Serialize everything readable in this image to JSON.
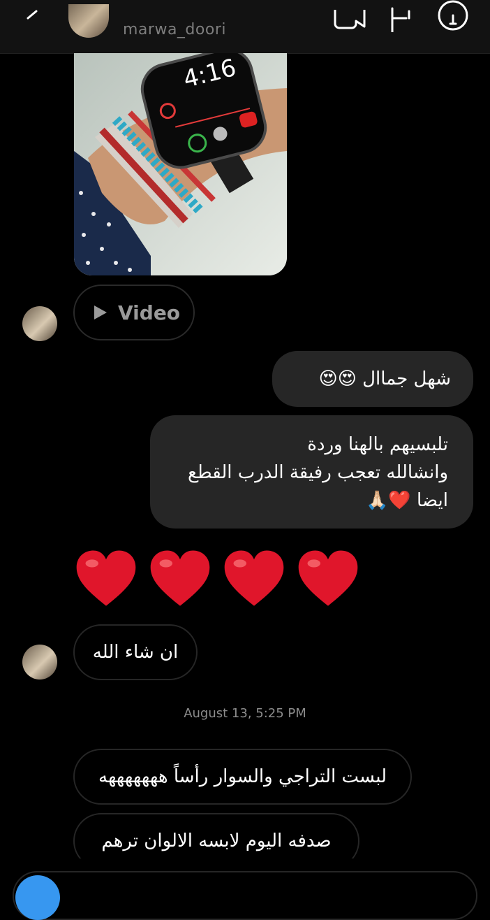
{
  "header": {
    "username": "marwa_doori"
  },
  "thread": {
    "video_label": "Video",
    "outgoing": [
      {
        "text": "شهل جماال 😍😍"
      },
      {
        "lines": [
          "تلبسيهم بالهنا وردة",
          "وانشالله تعجب رفيقة الدرب القطع",
          "ايضا ❤️🙏🏻"
        ]
      }
    ],
    "hearts_count": 4,
    "incoming": [
      {
        "text": "ان شاء الله"
      }
    ],
    "timestamp": "August 13, 5:25 PM",
    "incoming_after": [
      {
        "text": "لبست التراجي والسوار رأساً هههههههه"
      },
      {
        "text": "صدفه اليوم لابسه الالوان ترهم"
      }
    ]
  },
  "colors": {
    "bubble_out": "#262626",
    "background": "#000000",
    "accent": "#3797f0",
    "heart": "#e0162b"
  },
  "icons": [
    "back-arrow-icon",
    "video-call-icon",
    "flag-icon",
    "info-icon",
    "play-icon",
    "heart-icon",
    "camera-icon"
  ]
}
